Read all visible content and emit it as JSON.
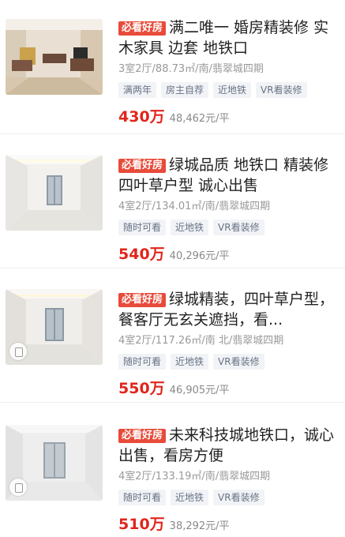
{
  "listings": [
    {
      "badge": "必看好房",
      "title": "满二唯一 婚房精装修 实木家具 边套 地铁口",
      "meta": "3室2厅/88.73㎡/南/翡翠城四期",
      "tags": [
        "满两年",
        "房主自荐",
        "近地铁",
        "VR看装修"
      ],
      "price": "430万",
      "unit_price": "48,462元/平"
    },
    {
      "badge": "必看好房",
      "title": "绿城品质 地铁口 精装修 四叶草户型 诚心出售",
      "meta": "4室2厅/134.01㎡/南/翡翠城四期",
      "tags": [
        "随时可看",
        "近地铁",
        "VR看装修"
      ],
      "price": "540万",
      "unit_price": "40,296元/平"
    },
    {
      "badge": "必看好房",
      "title": "绿城精装，四叶草户型，餐客厅无玄关遮挡，看...",
      "meta": "4室2厅/117.26㎡/南 北/翡翠城四期",
      "tags": [
        "随时可看",
        "近地铁",
        "VR看装修"
      ],
      "price": "550万",
      "unit_price": "46,905元/平"
    },
    {
      "badge": "必看好房",
      "title": "未来科技城地铁口，诚心出售，看房方便",
      "meta": "4室2厅/133.19㎡/南/翡翠城四期",
      "tags": [
        "随时可看",
        "近地铁",
        "VR看装修"
      ],
      "price": "510万",
      "unit_price": "38,292元/平"
    }
  ]
}
